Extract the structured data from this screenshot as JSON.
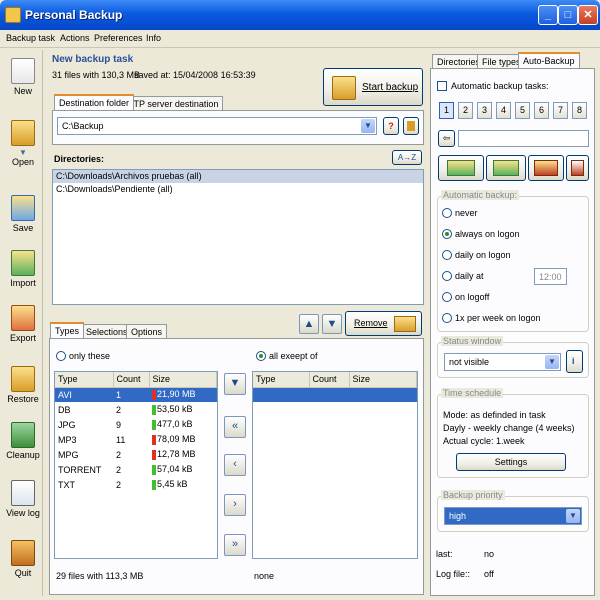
{
  "window": {
    "title": "Personal Backup"
  },
  "menu": [
    "Backup task",
    "Actions",
    "Preferences",
    "Info"
  ],
  "sidebar": [
    {
      "label": "New",
      "icon": "new-task-icon"
    },
    {
      "label": "Open",
      "icon": "open-icon"
    },
    {
      "label": "Save",
      "icon": "save-icon"
    },
    {
      "label": "Import",
      "icon": "import-icon"
    },
    {
      "label": "Export",
      "icon": "export-icon"
    },
    {
      "label": "Restore",
      "icon": "restore-icon"
    },
    {
      "label": "Cleanup",
      "icon": "trash-icon"
    },
    {
      "label": "View log",
      "icon": "log-icon"
    },
    {
      "label": "Quit",
      "icon": "quit-icon"
    }
  ],
  "task": {
    "title": "New backup task",
    "summary": "31 files with 130,3 MB",
    "saved": "saved at: 15/04/2008 16:53:39",
    "start_label": "Start backup"
  },
  "dest_tabs": [
    "Destination folder",
    "FTP server destination"
  ],
  "destination": {
    "value": "C:\\Backup",
    "help_label": "?"
  },
  "directories": {
    "label": "Directories:",
    "sort_label": "A→Z",
    "items": [
      "C:\\Downloads\\Archivos pruebas (all)",
      "C:\\Downloads\\Pendiente (all)"
    ]
  },
  "remove_label": "Remove",
  "filter_tabs": [
    "Types",
    "Selections",
    "Options"
  ],
  "filter": {
    "only_these": "only these",
    "all_except": "all exeept of",
    "columns": [
      "Type",
      "Count",
      "Size"
    ],
    "rows": [
      {
        "type": "AVI",
        "count": "1",
        "size": "21,90 MB",
        "color": "#e03020"
      },
      {
        "type": "DB",
        "count": "2",
        "size": "53,50 kB",
        "color": "#40c030"
      },
      {
        "type": "JPG",
        "count": "9",
        "size": "477,0 kB",
        "color": "#40c030"
      },
      {
        "type": "MP3",
        "count": "11",
        "size": "78,09 MB",
        "color": "#e03020"
      },
      {
        "type": "MPG",
        "count": "2",
        "size": "12,78 MB",
        "color": "#e03020"
      },
      {
        "type": "TORRENT",
        "count": "2",
        "size": "57,04 kB",
        "color": "#40c030"
      },
      {
        "type": "TXT",
        "count": "2",
        "size": "5,45 kB",
        "color": "#40c030"
      }
    ],
    "left_footer": "29 files with 113,3 MB",
    "right_footer": "none"
  },
  "right_tabs": [
    "Directories",
    "File types",
    "Auto-Backup"
  ],
  "auto": {
    "auto_tasks_label": "Automatic backup tasks:",
    "numbers": [
      "1",
      "2",
      "3",
      "4",
      "5",
      "6",
      "7",
      "8"
    ],
    "auto_backup_title": "Automatic backup:",
    "options": [
      "never",
      "always on logon",
      "daily on logon",
      "daily at",
      "on logoff",
      "1x per week on logon"
    ],
    "time": "12:00",
    "status_title": "Status window",
    "status_value": "not visible",
    "schedule_title": "Time schedule",
    "schedule_lines": [
      "Mode: as definded in task",
      "Dayly - weekly change (4 weeks)",
      "Actual cycle: 1.week"
    ],
    "settings_label": "Settings",
    "priority_title": "Backup priority",
    "priority_value": "high",
    "last_label": "last:",
    "last_value": "no",
    "logfile_label": "Log file::",
    "logfile_value": "off"
  }
}
